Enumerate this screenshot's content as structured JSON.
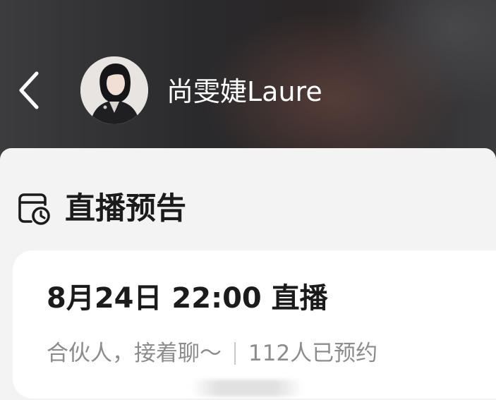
{
  "header": {
    "anchor_name": "尚雯婕Laure"
  },
  "icons": {
    "back": "chevron-left-icon",
    "section": "calendar-clock-icon"
  },
  "section": {
    "title": "直播预告"
  },
  "live_card": {
    "title": "8月24日 22:00 直播",
    "description": "合伙人，接着聊～",
    "reservations": "112人已预约"
  },
  "colors": {
    "title_text": "#1b1b1b",
    "secondary_text": "#8c8c8c",
    "card_bg": "#ffffff",
    "page_bg": "#f3f3f3"
  }
}
